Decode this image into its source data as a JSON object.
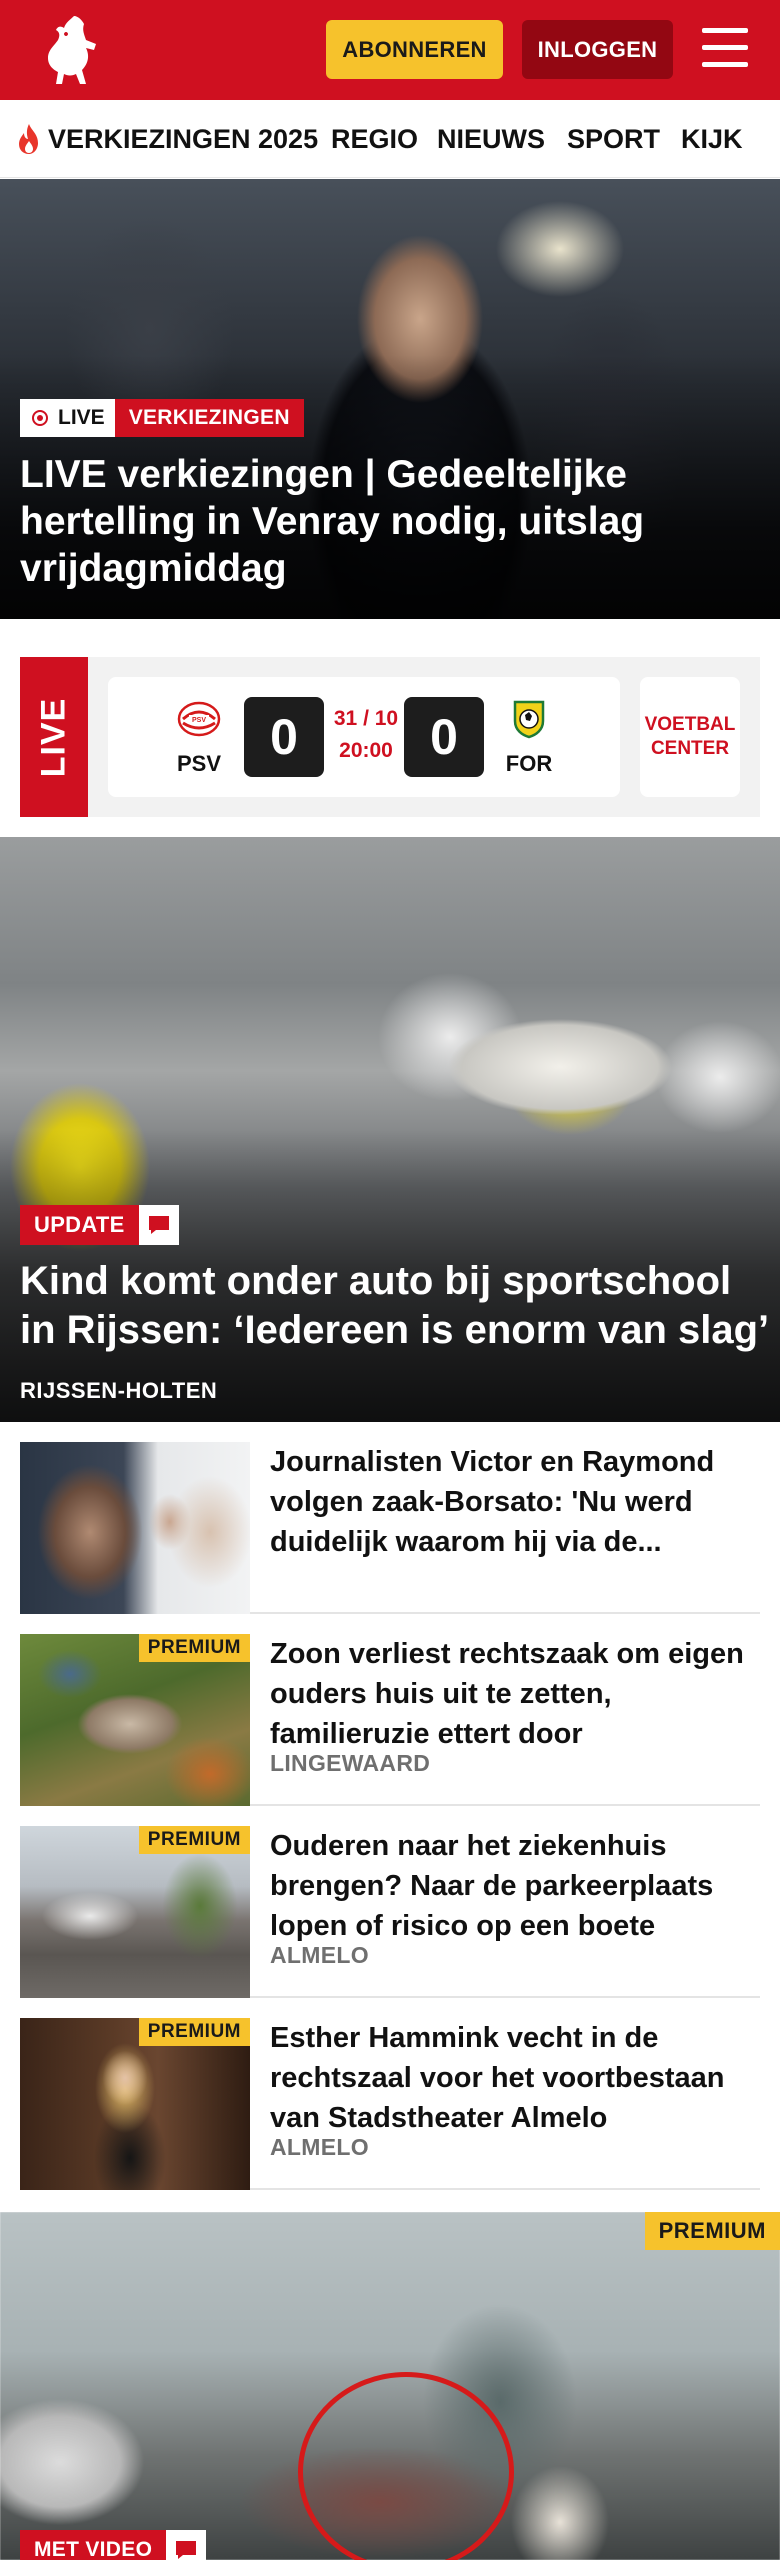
{
  "header": {
    "subscribe_label": "ABONNEREN",
    "login_label": "INLOGGEN",
    "brand_color": "#cf1020",
    "subscribe_color": "#f6c22c",
    "login_color": "#930712"
  },
  "nav": {
    "items": [
      {
        "label": "VERKIEZINGEN 2025",
        "icon": "flame-icon"
      },
      {
        "label": "REGIO"
      },
      {
        "label": "NIEUWS"
      },
      {
        "label": "SPORT"
      },
      {
        "label": "KIJK"
      }
    ]
  },
  "hero": {
    "live_tag": "LIVE",
    "category_tag": "VERKIEZINGEN",
    "title": "LIVE verkiezingen | Gedeeltelijke hertelling in Venray nodig, uitslag vrijdagmiddag"
  },
  "live_score": {
    "label": "LIVE",
    "home_team": "PSV",
    "away_team": "FOR",
    "home_score": "0",
    "away_score": "0",
    "date": "31 / 10",
    "time": "20:00",
    "voetbal_center": "VOETBAL CENTER"
  },
  "main_article": {
    "tag": "UPDATE",
    "title": "Kind komt onder auto bij sportschool in Rijssen: ‘Iedereen is enorm van slag’",
    "location": "RIJSSEN-HOLTEN"
  },
  "list": [
    {
      "title": "Journalisten Victor en Raymond volgen zaak-Borsato: 'Nu werd duidelijk waarom hij via de...",
      "location": "",
      "premium": false
    },
    {
      "title": "Zoon verliest rechtszaak om eigen ouders huis uit te zetten, familieruzie ettert door",
      "location": "LINGEWAARD",
      "premium": true
    },
    {
      "title": "Ouderen naar het ziekenhuis brengen? Naar de parkeerplaats lopen of risico op een boete",
      "location": "ALMELO",
      "premium": true
    },
    {
      "title": "Esther Hammink vecht in de rechtszaal voor het voortbestaan van Stadstheater Almelo",
      "location": "ALMELO",
      "premium": true
    }
  ],
  "premium_label": "PREMIUM",
  "video": {
    "premium_label": "PREMIUM",
    "tag": "MET VIDEO"
  }
}
